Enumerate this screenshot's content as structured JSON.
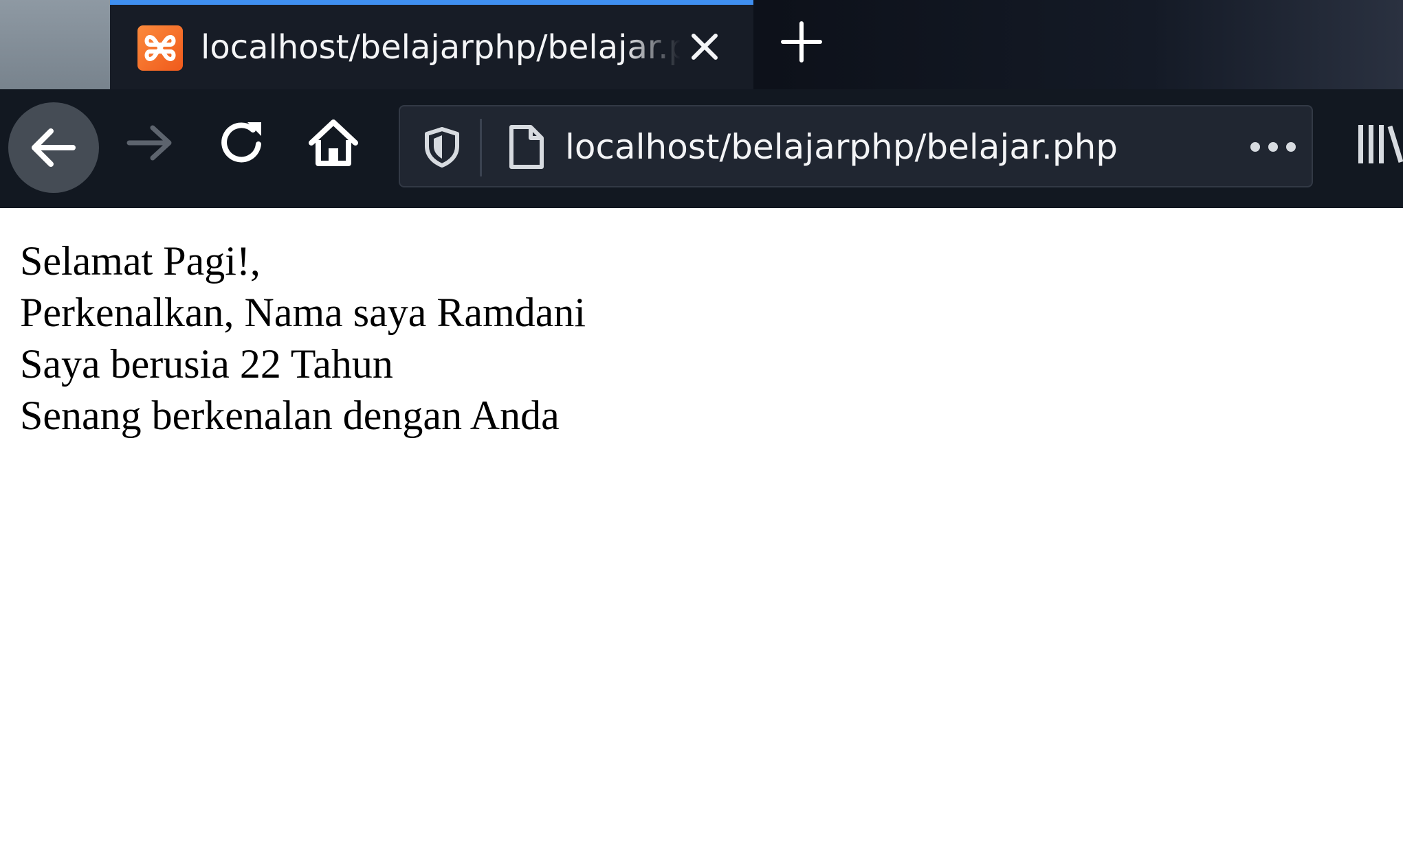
{
  "browser": {
    "tab": {
      "title": "localhost/belajarphp/belajar.php",
      "favicon": "xampp-icon",
      "accent_color": "#3f8ff0"
    },
    "icons": {
      "close": "close-icon",
      "new_tab": "plus-icon",
      "back": "back-arrow-icon",
      "forward": "forward-arrow-icon",
      "reload": "reload-icon",
      "home": "home-icon",
      "shield": "shield-icon",
      "page": "page-icon",
      "page_actions": "more-dots-icon",
      "library": "library-icon"
    },
    "url": "localhost/belajarphp/belajar.php"
  },
  "page": {
    "lines": [
      "Selamat Pagi!,",
      "Perkenalkan, Nama saya Ramdani",
      "Saya berusia 22 Tahun",
      "Senang berkenalan dengan Anda"
    ]
  }
}
